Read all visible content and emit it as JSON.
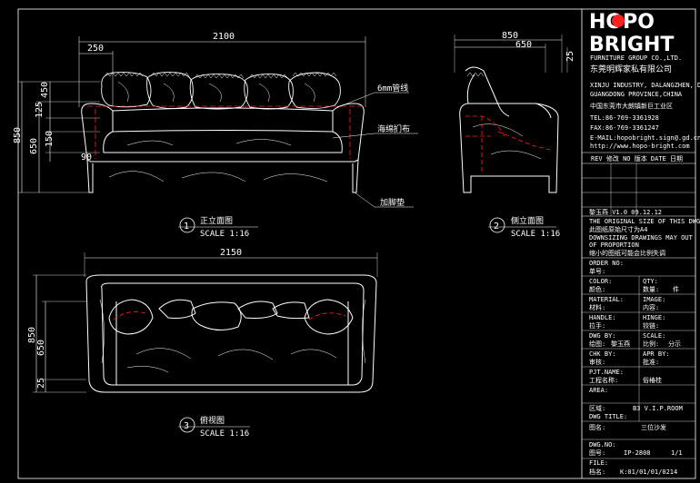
{
  "brand": {
    "logo_line1": "HOPO",
    "logo_line2": "BRIGHT",
    "group": "FURNITURE GROUP CO.,LTD.",
    "company_cn": "东莞明辉家私有限公司",
    "address_en_1": "XINJU INDUSTRY, DALANGZHEN, DONGGUAN",
    "address_en_2": "GUANGDONG PROVINCE,CHINA",
    "address_cn": "中国东莞市大朗镇新巨工业区",
    "tel": "TEL:86-769-3361928",
    "fax": "FAX:86-769-3361247",
    "email": "E-MAIL:hopobright.sign@.gd.cn",
    "web": "http://www.hopo-bright.com"
  },
  "views": {
    "front": {
      "num": "1",
      "title": "正立面图",
      "scale": "SCALE 1:16"
    },
    "side": {
      "num": "2",
      "title": "侧立面图",
      "scale": "SCALE 1:16"
    },
    "top": {
      "num": "3",
      "title": "俯视图",
      "scale": "SCALE 1:16"
    }
  },
  "dimensions": {
    "front_width": "2100",
    "front_arm": "250",
    "front_height": "850",
    "front_seat": "650",
    "front_450": "450",
    "front_125": "125",
    "front_150": "150",
    "front_90": "90",
    "side_depth": "850",
    "side_650": "650",
    "side_25": "25",
    "top_width": "2150",
    "top_depth": "850",
    "top_650": "650",
    "top_25": "25"
  },
  "callouts": {
    "piping": "6mm管线",
    "cushion": "海绵扪布",
    "leg": "加脚垫"
  },
  "title_block": {
    "rev_header": "REV 修改  NO 版本  DATE 日期",
    "rev_row": "黎玉燕  V1.0  09.12.12",
    "note_1": "THE ORIGINAL SIZE OF THIS DWG IS A4",
    "note_2": "此图纸原始尺寸为A4",
    "note_3": "DOWNSIZING DRAWINGS MAY OUT",
    "note_4": "OF PROPORTION",
    "note_5": "缩小的图纸可能会比例失调",
    "order_no": "ORDER NO:",
    "order_cn": "单号:",
    "color_label": "COLOR:",
    "color_cn": "颜色:",
    "qty_label": "QTY:",
    "qty_cn": "数量:",
    "qty_unit": "件",
    "material_label": "MATERIAL:",
    "material_cn": "材料:",
    "image_label": "IMAGE:",
    "image_cn": "内容:",
    "handle_label": "HANDLE:",
    "handle_cn": "拉手:",
    "hinge_label": "HINGE:",
    "hinge_cn": "铰链:",
    "dwg_by_label": "DWG BY:",
    "dwg_by_cn": "绘图:",
    "dwg_by_value": "黎玉燕",
    "scale_label": "SCALE:",
    "scale_cn": "比例:",
    "scale_value": "分示",
    "chk_label": "CHK BY:",
    "chk_cn": "审核:",
    "apr_label": "APR BY:",
    "apr_cn": "批准:",
    "pjt_label": "PJT.NAME:",
    "pjt_cn": "工程名称:",
    "pjt_value": "俗椿桂",
    "area_label": "AREA:",
    "area_cn": "区域:",
    "area_value": "B3 V.I.P.ROOM",
    "dwg_title_label": "DWG TITLE:",
    "dwg_title_cn": "图名:",
    "dwg_title_value": "三位沙发",
    "dwg_no_label": "DWG.NO:",
    "dwg_no_cn": "图号:",
    "dwg_no_value": "IP-2808",
    "sheet": "1/1",
    "file_label": "FILE:",
    "file_cn": "档名:",
    "file_value": "K:01/01/01/0214"
  }
}
